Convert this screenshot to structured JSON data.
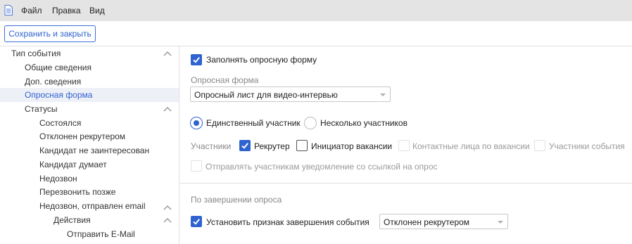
{
  "menu": {
    "file": "Файл",
    "edit": "Правка",
    "view": "Вид"
  },
  "toolbar": {
    "save_close": "Сохранить и закрыть"
  },
  "tree": {
    "items": [
      {
        "label": "Тип события"
      },
      {
        "label": "Общие сведения"
      },
      {
        "label": "Доп. сведения"
      },
      {
        "label": "Опросная форма"
      },
      {
        "label": "Статусы"
      },
      {
        "label": "Состоялся"
      },
      {
        "label": "Отклонен рекрутером"
      },
      {
        "label": "Кандидат не заинтересован"
      },
      {
        "label": "Кандидат думает"
      },
      {
        "label": "Недозвон"
      },
      {
        "label": "Перезвонить позже"
      },
      {
        "label": "Недозвон, отправлен email"
      },
      {
        "label": "Действия"
      },
      {
        "label": "Отправить E-Mail"
      }
    ]
  },
  "form": {
    "fill_survey": {
      "label": "Заполнять опросную форму",
      "checked": true
    },
    "survey_form": {
      "label": "Опросная форма",
      "value": "Опросный лист для видео-интервью"
    },
    "participation": {
      "single": {
        "label": "Единственный участник",
        "selected": true
      },
      "multiple": {
        "label": "Несколько участников",
        "selected": false
      }
    },
    "participants": {
      "label": "Участники",
      "recruiter": {
        "label": "Рекрутер",
        "checked": true
      },
      "initiator": {
        "label": "Инициатор вакансии",
        "checked": false
      },
      "contacts": {
        "label": "Контактные лица по вакансии",
        "disabled": true
      },
      "event_participants": {
        "label": "Участники события",
        "disabled": true
      }
    },
    "notify": {
      "label": "Отправлять участникам уведомление со ссылкой на опрос",
      "disabled": true
    },
    "completion": {
      "header": "По завершении опроса",
      "set_flag": {
        "label": "Установить признак завершения события",
        "checked": true
      },
      "status": {
        "value": "Отклонен рекрутером"
      }
    }
  },
  "colors": {
    "accent": "#2f63cf",
    "menubar": "#e4e4e4",
    "active_row": "#eef0f8"
  }
}
